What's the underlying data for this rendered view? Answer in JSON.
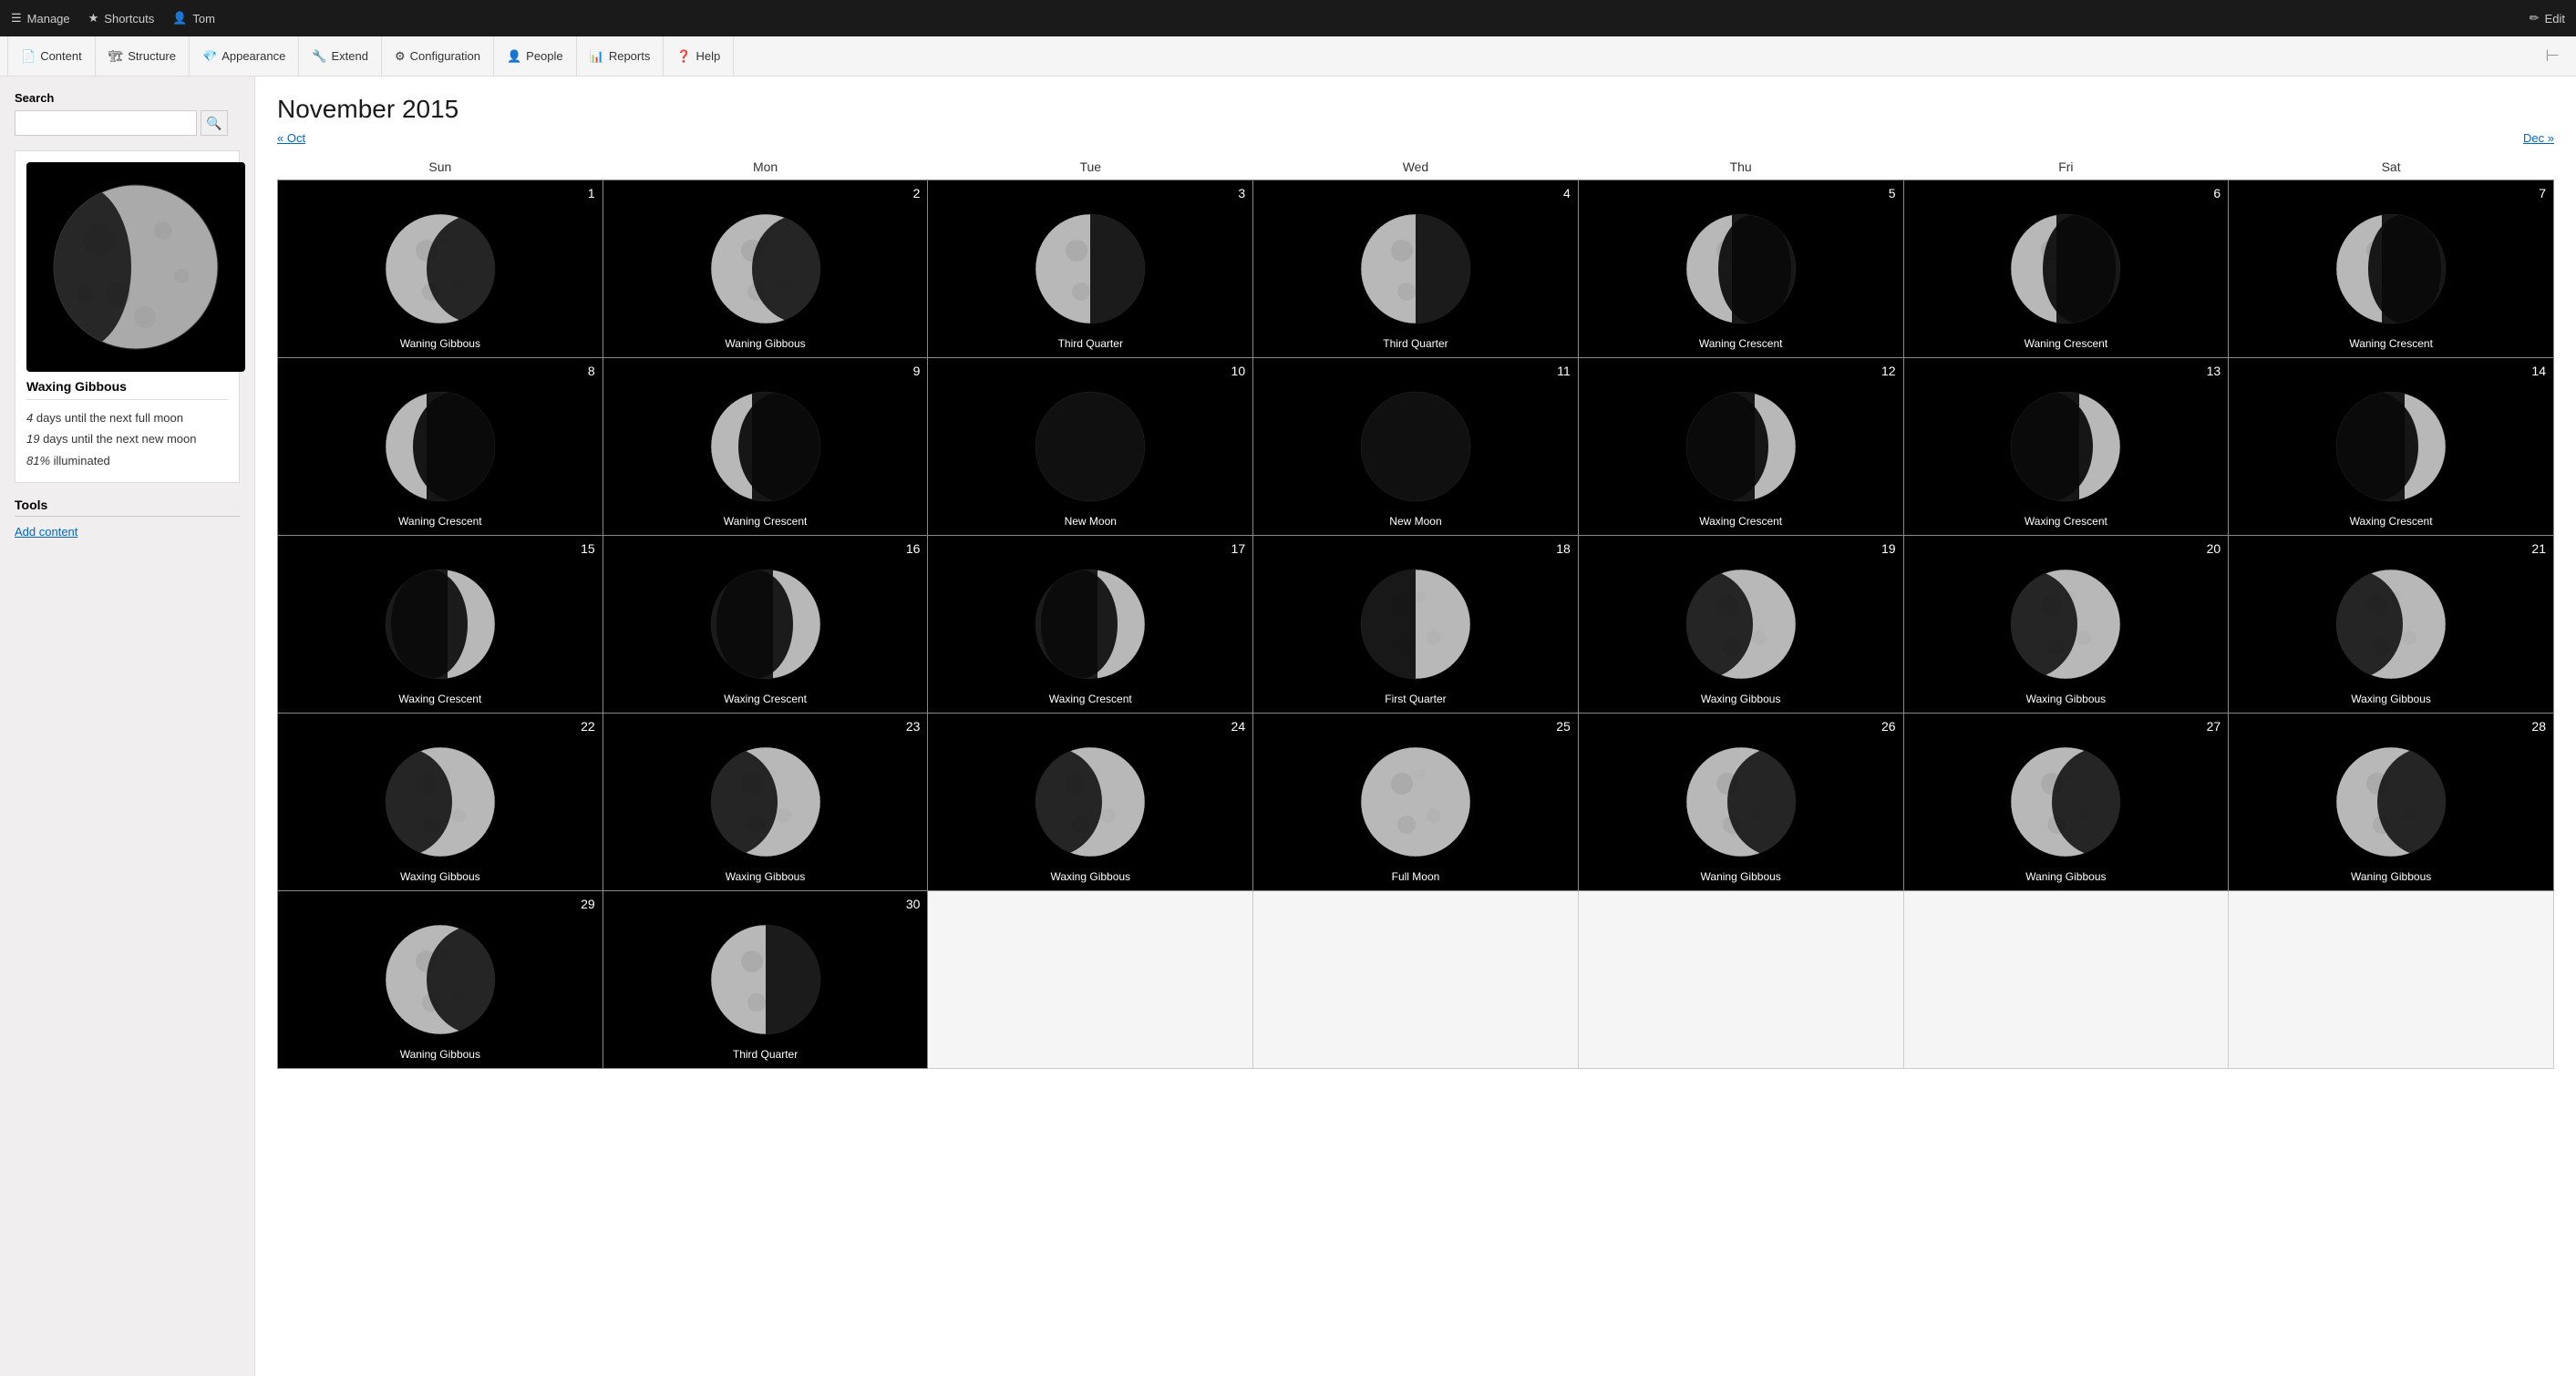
{
  "admin_bar": {
    "manage_label": "Manage",
    "shortcuts_label": "Shortcuts",
    "user_label": "Tom",
    "edit_label": "Edit"
  },
  "nav": {
    "items": [
      {
        "id": "content",
        "label": "Content",
        "icon": "📄"
      },
      {
        "id": "structure",
        "label": "Structure",
        "icon": "🏗"
      },
      {
        "id": "appearance",
        "label": "Appearance",
        "icon": "💎"
      },
      {
        "id": "extend",
        "label": "Extend",
        "icon": "🔧"
      },
      {
        "id": "configuration",
        "label": "Configuration",
        "icon": "⚙"
      },
      {
        "id": "people",
        "label": "People",
        "icon": "👤"
      },
      {
        "id": "reports",
        "label": "Reports",
        "icon": "📊"
      },
      {
        "id": "help",
        "label": "Help",
        "icon": "❓"
      }
    ]
  },
  "sidebar": {
    "search_label": "Search",
    "search_placeholder": "",
    "moon_title": "Waxing Gibbous",
    "moon_info": {
      "line1_prefix": "",
      "line1_count": "4",
      "line1_suffix": " days until the next full moon",
      "line2_prefix": "",
      "line2_count": "19",
      "line2_suffix": " days until the next new moon",
      "line3": "81% illuminated"
    },
    "tools_title": "Tools",
    "add_content_label": "Add content"
  },
  "main": {
    "title": "November 2015",
    "prev_label": "« Oct",
    "next_label": "Dec »",
    "weekdays": [
      "Sun",
      "Mon",
      "Tue",
      "Wed",
      "Thu",
      "Fri",
      "Sat"
    ],
    "days": [
      {
        "day": 1,
        "phase": "Waning Gibbous",
        "type": "waning-gibbous",
        "col": 0
      },
      {
        "day": 2,
        "phase": "Waning Gibbous",
        "type": "waning-gibbous",
        "col": 1
      },
      {
        "day": 3,
        "phase": "Third Quarter",
        "type": "third-quarter",
        "col": 2
      },
      {
        "day": 4,
        "phase": "Third Quarter",
        "type": "third-quarter",
        "col": 3
      },
      {
        "day": 5,
        "phase": "Waning Crescent",
        "type": "waning-crescent-early",
        "col": 4
      },
      {
        "day": 6,
        "phase": "Waning Crescent",
        "type": "waning-crescent-early",
        "col": 5
      },
      {
        "day": 7,
        "phase": "Waning Crescent",
        "type": "waning-crescent-early",
        "col": 6
      },
      {
        "day": 8,
        "phase": "Waning Crescent",
        "type": "waning-crescent-late",
        "col": 0
      },
      {
        "day": 9,
        "phase": "Waning Crescent",
        "type": "waning-crescent-late",
        "col": 1
      },
      {
        "day": 10,
        "phase": "New Moon",
        "type": "new-moon",
        "col": 2
      },
      {
        "day": 11,
        "phase": "New Moon",
        "type": "new-moon",
        "col": 3
      },
      {
        "day": 12,
        "phase": "Waxing Crescent",
        "type": "waxing-crescent-early",
        "col": 4
      },
      {
        "day": 13,
        "phase": "Waxing Crescent",
        "type": "waxing-crescent-early",
        "col": 5
      },
      {
        "day": 14,
        "phase": "Waxing Crescent",
        "type": "waxing-crescent-early",
        "col": 6
      },
      {
        "day": 15,
        "phase": "Waxing Crescent",
        "type": "waxing-crescent-mid",
        "col": 0
      },
      {
        "day": 16,
        "phase": "Waxing Crescent",
        "type": "waxing-crescent-mid",
        "col": 1
      },
      {
        "day": 17,
        "phase": "Waxing Crescent",
        "type": "waxing-crescent-mid",
        "col": 2
      },
      {
        "day": 18,
        "phase": "First Quarter",
        "type": "first-quarter",
        "col": 3
      },
      {
        "day": 19,
        "phase": "Waxing Gibbous",
        "type": "waxing-gibbous",
        "col": 4
      },
      {
        "day": 20,
        "phase": "Waxing Gibbous",
        "type": "waxing-gibbous",
        "col": 5
      },
      {
        "day": 21,
        "phase": "Waxing Gibbous",
        "type": "waxing-gibbous",
        "col": 6
      }
    ]
  }
}
